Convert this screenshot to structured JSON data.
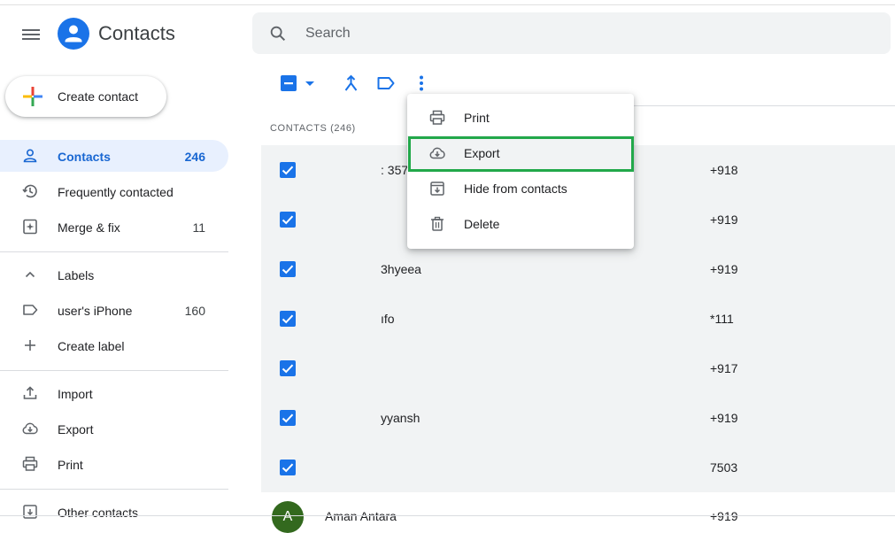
{
  "header": {
    "app_title": "Contacts",
    "search_placeholder": "Search"
  },
  "sidebar": {
    "create_label": "Create contact",
    "items": [
      {
        "label": "Contacts",
        "count": "246"
      },
      {
        "label": "Frequently contacted",
        "count": ""
      },
      {
        "label": "Merge & fix",
        "count": "11"
      },
      {
        "label": "Labels",
        "count": ""
      },
      {
        "label": "user's iPhone",
        "count": "160"
      },
      {
        "label": "Create label",
        "count": ""
      },
      {
        "label": "Import",
        "count": ""
      },
      {
        "label": "Export",
        "count": ""
      },
      {
        "label": "Print",
        "count": ""
      },
      {
        "label": "Other contacts",
        "count": ""
      }
    ]
  },
  "list": {
    "header": "CONTACTS (246)",
    "rows": [
      {
        "name": ": 357",
        "phone": "+918"
      },
      {
        "name": "",
        "phone": "+919"
      },
      {
        "name": "3hyeea",
        "phone": "+919"
      },
      {
        "name": "ıfo",
        "phone": "*111"
      },
      {
        "name": "",
        "phone": "+917"
      },
      {
        "name": "yyansh",
        "phone": "+919"
      },
      {
        "name": "",
        "phone": "7503"
      }
    ],
    "last_row": {
      "avatar_letter": "A",
      "name": "Aman Antara",
      "phone": "+919"
    }
  },
  "menu": {
    "items": [
      {
        "label": "Print"
      },
      {
        "label": "Export"
      },
      {
        "label": "Hide from contacts"
      },
      {
        "label": "Delete"
      }
    ]
  },
  "colors": {
    "accent": "#1a73e8",
    "active_bg": "#e8f0fe",
    "highlight": "#22a84a"
  }
}
